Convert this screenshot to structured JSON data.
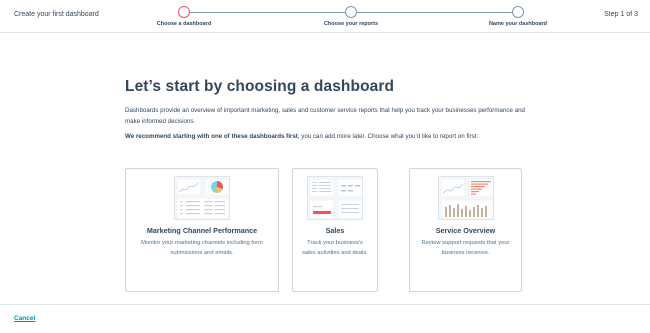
{
  "header": {
    "title": "Create your first dashboard",
    "step_count": "Step 1 of 3",
    "steps": [
      {
        "label": "Choose a dashboard",
        "active": true
      },
      {
        "label": "Choose your reports",
        "active": false
      },
      {
        "label": "Name your dashboard",
        "active": false
      }
    ]
  },
  "main": {
    "title": "Let’s start by choosing a dashboard",
    "description": "Dashboards provide an overview of important marketing, sales and customer service reports that help you track your businesses performance and make informed decisions.",
    "recommendation_bold": "We recommend starting with one of these dashboards first",
    "recommendation_rest": ", you can add more later. Choose what you’d like to report on first:"
  },
  "cards": [
    {
      "title": "Marketing Channel Performance",
      "description": "Monitor your marketing channels including form submissions and emails.",
      "icon": "marketing-dashboard-thumbnail"
    },
    {
      "title": "Sales",
      "description": "Track your business’s sales activities and deals.",
      "icon": "sales-dashboard-thumbnail"
    },
    {
      "title": "Service Overview",
      "description": "Review support requests that your business receives.",
      "icon": "service-dashboard-thumbnail"
    }
  ],
  "footer": {
    "cancel_label": "Cancel"
  },
  "colors": {
    "accent": "#f2545b",
    "link": "#0091ae",
    "text": "#33475b",
    "border": "#cbd6e2"
  }
}
